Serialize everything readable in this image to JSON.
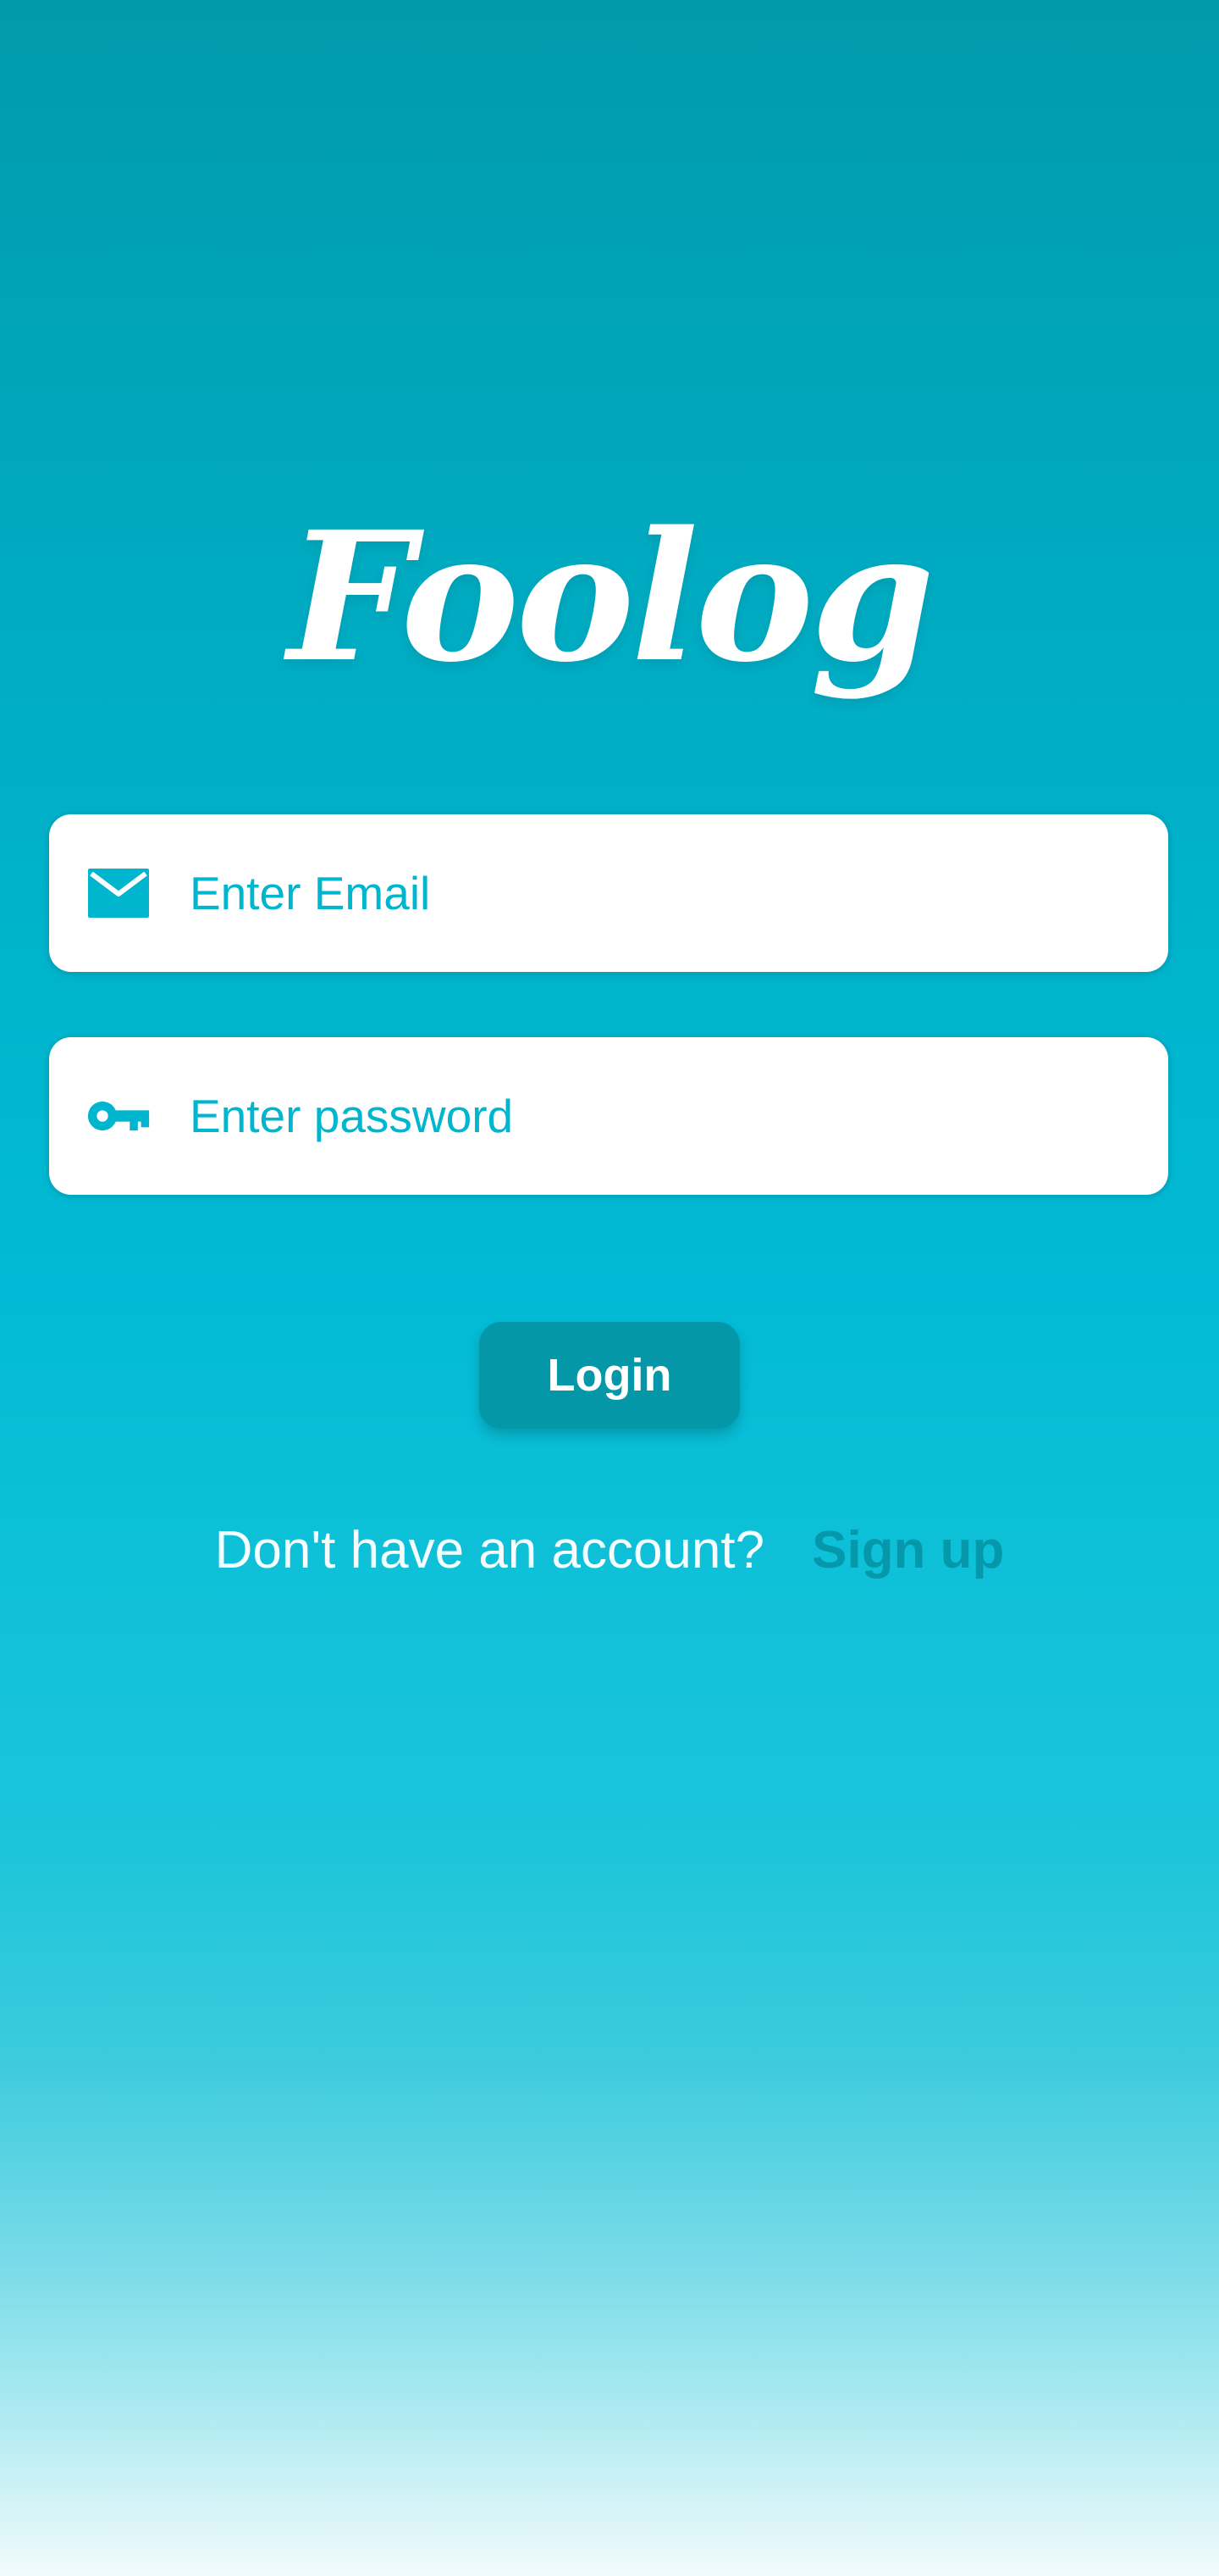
{
  "app": {
    "logo_text": "Foolog"
  },
  "form": {
    "email": {
      "placeholder": "Enter Email",
      "value": "",
      "icon": "mail-icon"
    },
    "password": {
      "placeholder": "Enter password",
      "value": "",
      "icon": "key-icon"
    },
    "login_label": "Login"
  },
  "footer": {
    "question": "Don't have an account?",
    "signup_label": "Sign up"
  },
  "colors": {
    "accent": "#00b6cf",
    "button": "#0397a8",
    "signup_link": "#0597aa"
  }
}
